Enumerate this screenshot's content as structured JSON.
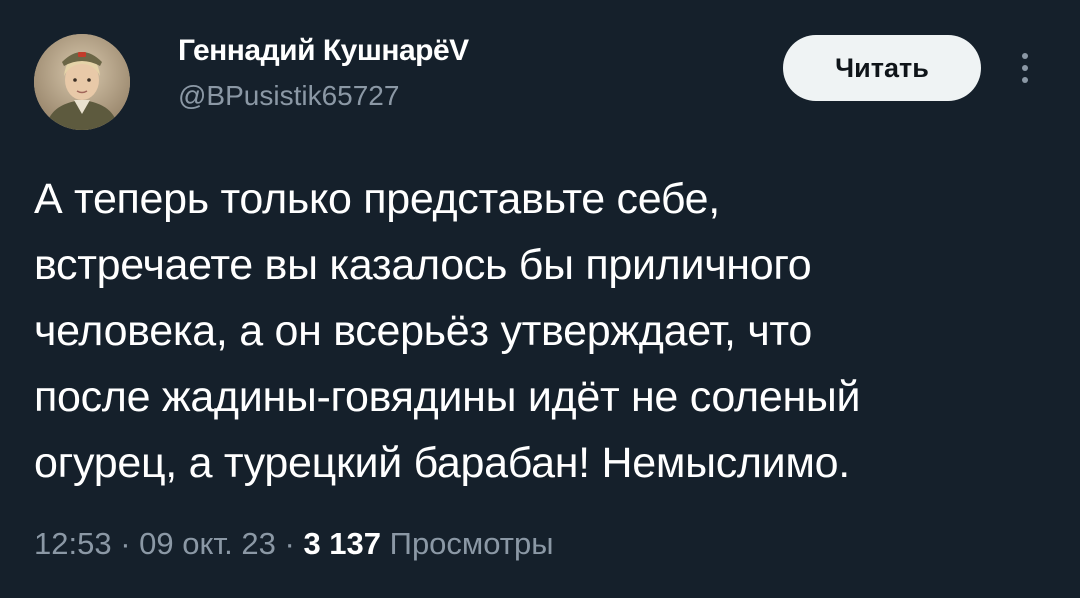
{
  "author": {
    "display_name": "Геннадий КушнарёV",
    "handle": "@BPusistik65727"
  },
  "follow_button": {
    "label": "Читать"
  },
  "more_icon": "vertical-ellipsis",
  "tweet": {
    "text_lines": [
      "А теперь только представьте себе,",
      "встречаете вы казалось бы приличного",
      "человека, а он всерьёз утверждает, что",
      "после жадины-говядины идёт не соленый",
      "огурец, а турецкий барабан! Немыслимо."
    ]
  },
  "meta": {
    "time": "12:53",
    "separator": "·",
    "date": "09 окт. 23",
    "views_count": "3 137",
    "views_label": "Просмотры"
  },
  "colors": {
    "background": "#15202b",
    "text_primary": "#ffffff",
    "text_secondary": "#8b98a5",
    "button_bg": "#eff3f4",
    "button_text": "#0f1419"
  }
}
